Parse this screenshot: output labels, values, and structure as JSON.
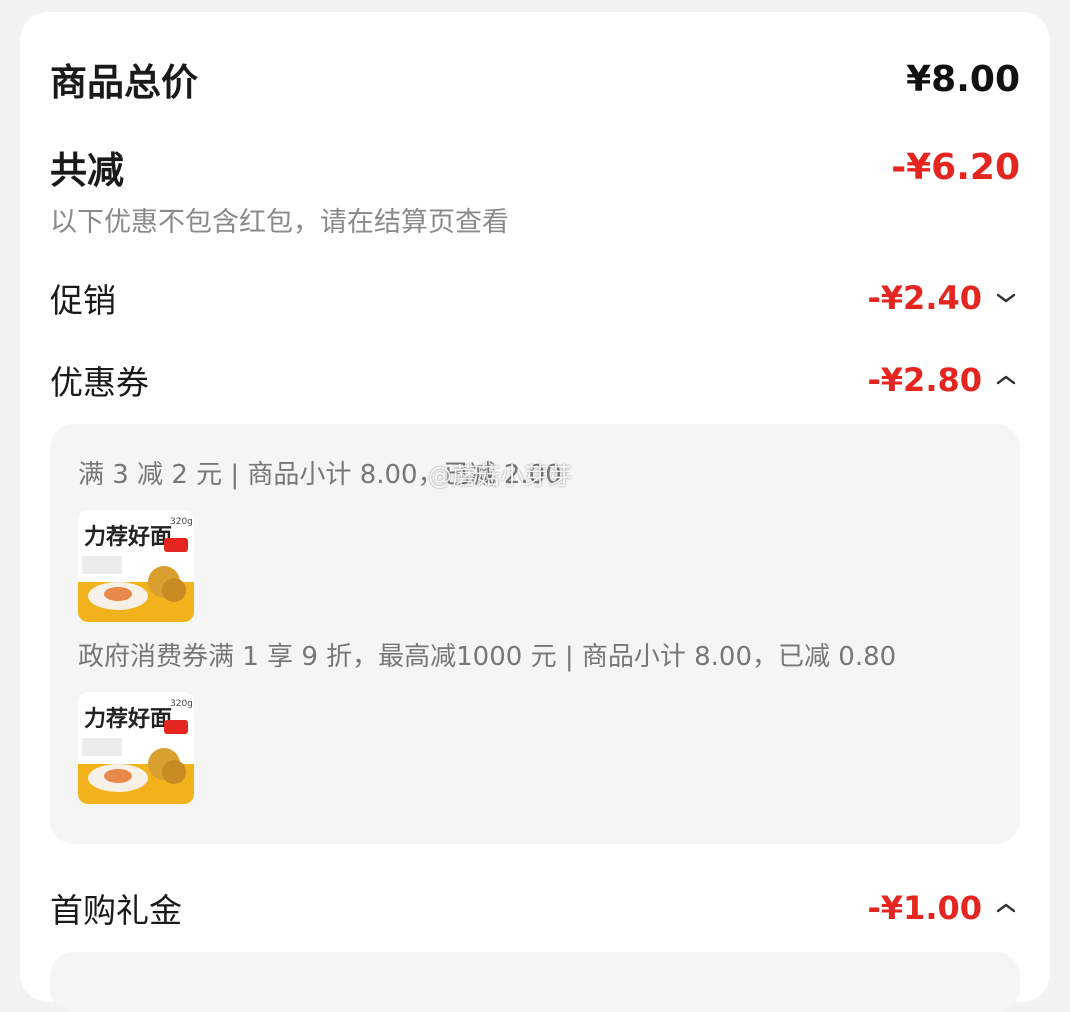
{
  "summary": {
    "goods_total_label": "商品总价",
    "goods_total_value": "¥8.00",
    "total_discount_label": "共减",
    "total_discount_value": "-¥6.20",
    "note": "以下优惠不包含红包，请在结算页查看"
  },
  "rows": {
    "promotion": {
      "label": "促销",
      "value": "-¥2.40",
      "chevron": "chevron-down-icon"
    },
    "coupon": {
      "label": "优惠券",
      "value": "-¥2.80",
      "chevron": "chevron-up-icon"
    },
    "first_purchase": {
      "label": "首购礼金",
      "value": "-¥1.00",
      "chevron": "chevron-up-icon"
    }
  },
  "coupon_details": [
    {
      "text": "满 3 减 2 元 | 商品小计 8.00，已减 2.00"
    },
    {
      "text": "政府消费券满 1 享 9 折，最高减1000 元 | 商品小计 8.00，已减 0.80"
    }
  ],
  "product_thumb": {
    "brand_text": "力荐好面",
    "weight": "320g"
  },
  "watermark": "@蘑菇小芽芽",
  "colors": {
    "accent_red": "#e52620",
    "panel_bg": "#f5f5f5",
    "muted": "#8a8a8a"
  }
}
